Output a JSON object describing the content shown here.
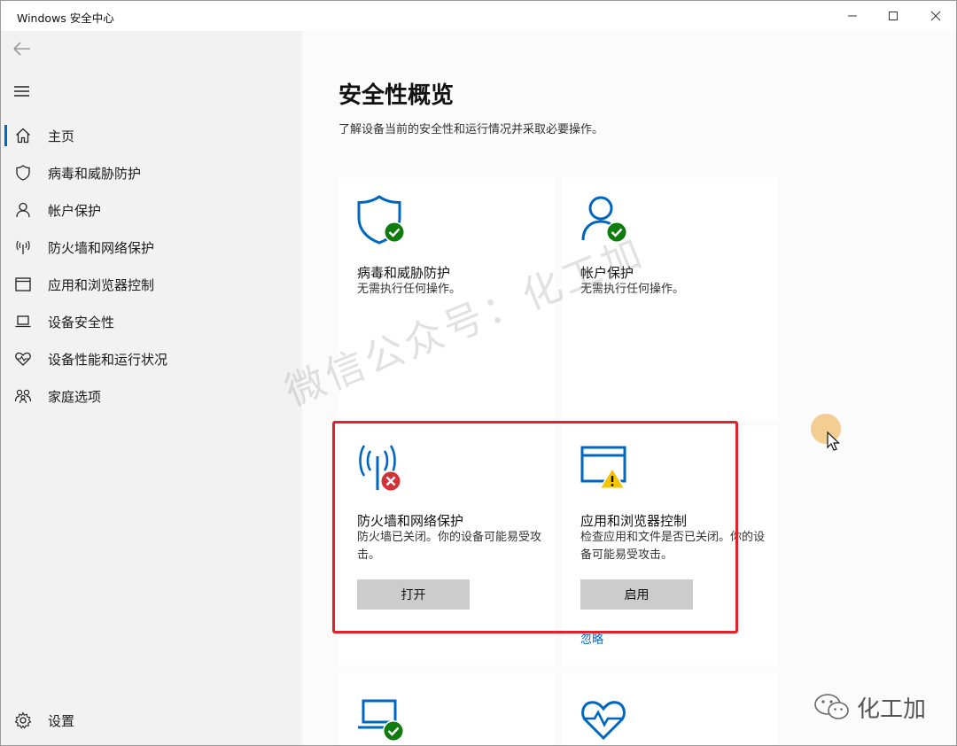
{
  "window": {
    "title": "Windows 安全中心"
  },
  "sidebar": {
    "items": [
      {
        "label": "主页",
        "icon": "home-icon",
        "active": true
      },
      {
        "label": "病毒和威胁防护",
        "icon": "shield-icon"
      },
      {
        "label": "帐户保护",
        "icon": "person-icon"
      },
      {
        "label": "防火墙和网络保护",
        "icon": "antenna-icon"
      },
      {
        "label": "应用和浏览器控制",
        "icon": "window-icon"
      },
      {
        "label": "设备安全性",
        "icon": "laptop-icon"
      },
      {
        "label": "设备性能和运行状况",
        "icon": "heart-icon"
      },
      {
        "label": "家庭选项",
        "icon": "family-icon"
      }
    ],
    "settings_label": "设置"
  },
  "main": {
    "title": "安全性概览",
    "description": "了解设备当前的安全性和运行情况并采取必要操作。",
    "cards": [
      {
        "title": "病毒和威胁防护",
        "desc": "无需执行任何操作。",
        "icon": "shield-check-icon",
        "status": "ok"
      },
      {
        "title": "帐户保护",
        "desc": "无需执行任何操作。",
        "icon": "person-check-icon",
        "status": "ok"
      },
      {
        "title": "防火墙和网络保护",
        "desc": "防火墙已关闭。你的设备可能易受攻击。",
        "icon": "antenna-error-icon",
        "status": "error",
        "button": "打开"
      },
      {
        "title": "应用和浏览器控制",
        "desc": "检查应用和文件是否已关闭。你的设备可能易受攻击。",
        "icon": "window-warning-icon",
        "status": "warning",
        "button": "启用",
        "link": "忽略"
      }
    ]
  },
  "overlay": {
    "watermark": "微信公众号：化工加",
    "brand": "化工加"
  },
  "colors": {
    "accent_blue": "#0067c0",
    "ok_green": "#107c10",
    "error_red": "#d13438",
    "warning_yellow": "#f5c400",
    "highlight_red": "#e2222b"
  }
}
